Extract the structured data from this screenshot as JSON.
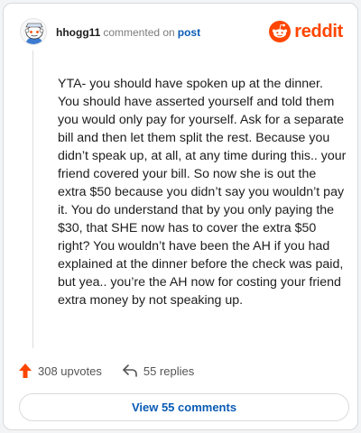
{
  "header": {
    "username": "hhogg11",
    "action": "commented on",
    "post_link": "post",
    "brand": "reddit"
  },
  "comment": {
    "text": "YTA- you should have spoken up at the dinner. You should have asserted yourself and told them you would only pay for yourself. Ask for a separate bill and then let them split the rest. Because you didn’t speak up, at all, at any time during this.. your friend covered your bill. So now she is out the extra $50 because you didn’t say you wouldn’t pay it. You do understand that by you only paying the $30, that SHE now has to cover the extra $50 right? You wouldn’t have been the AH if you had explained at the dinner before the check was paid, but yea.. you’re the AH now for costing your friend extra money by not speaking up."
  },
  "actions": {
    "upvotes": "308 upvotes",
    "replies": "55 replies"
  },
  "footer": {
    "view_comments": "View 55 comments"
  },
  "icons": {
    "avatar": "snoo-avatar-icon",
    "brand": "reddit-logo-icon",
    "upvote": "upvote-arrow-icon",
    "reply": "reply-arrow-icon"
  },
  "colors": {
    "brand": "#ff4500",
    "link": "#0a5bb5"
  }
}
